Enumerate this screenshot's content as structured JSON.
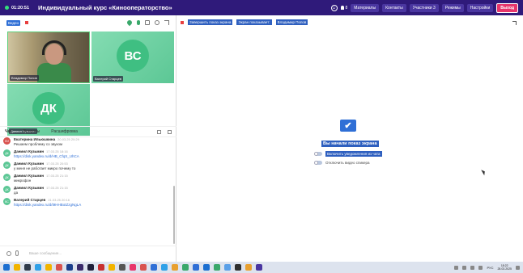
{
  "topbar": {
    "timer": "01:20:51",
    "title": "Индивидуальный курс «Кинооператорство»",
    "reaction_count": "8",
    "nav": [
      "Материалы",
      "Контакты",
      "Участники 3",
      "Режимы",
      "Настройки"
    ],
    "exit_label": "Выход"
  },
  "left_toolbar": {
    "video_badge": "Видео"
  },
  "tiles": [
    {
      "name": "Владимир Попов",
      "type": "camera"
    },
    {
      "name": "Валерий Старцев",
      "initials": "ВС",
      "type": "avatar"
    },
    {
      "name": "Даниил Кузьмин",
      "initials": "ДК",
      "type": "avatar"
    }
  ],
  "chat": {
    "tabs": [
      "Чат",
      "Вопросы",
      "Расшифровка"
    ],
    "messages": [
      {
        "initials": "ЕИ",
        "color": "#d9534f",
        "author": "Екатерина Ильюшкина",
        "time": "20.03.25 20:29",
        "text": "Решаем проблему со звуком",
        "link": ""
      },
      {
        "initials": "ДК",
        "color": "#5cc795",
        "author": "Даниил Кузьмин",
        "time": "17.03.25 18:16",
        "text": "",
        "link": "https://disk.yandex.ru/d/HB_CfqS_UhCA"
      },
      {
        "initials": "ДК",
        "color": "#5cc795",
        "author": "Даниил Кузьмин",
        "time": "17.03.25 20:53",
        "text": "у меня не работает микро почему то",
        "link": ""
      },
      {
        "initials": "ДК",
        "color": "#5cc795",
        "author": "Даниил Кузьмин",
        "time": "17.03.25 21:15",
        "text": "микрофон",
        "link": ""
      },
      {
        "initials": "ДК",
        "color": "#5cc795",
        "author": "Даниил Кузьмин",
        "time": "17.03.25 21:15",
        "text": "да",
        "link": ""
      },
      {
        "initials": "ВС",
        "color": "#5cc795",
        "author": "Валерий Старцев",
        "time": "21.03.25 20:16",
        "text": "",
        "link": "https://disk.yandex.ru/d/t9HHBotZzgNgLA"
      }
    ],
    "input_placeholder": "Ваше сообщение..."
  },
  "screenshare": {
    "stop_label": "Завершить показ экрана",
    "sharing_label": "Экран показывает:",
    "sharer_name": "Владимир Попов",
    "started_text": "Вы начали показ экрана",
    "toggle1": "Включить уведомления из чата",
    "toggle2": "Отключить видео спикера"
  },
  "taskbar": {
    "lang": "РУС",
    "time": "18:22",
    "date": "28.03.2025"
  }
}
